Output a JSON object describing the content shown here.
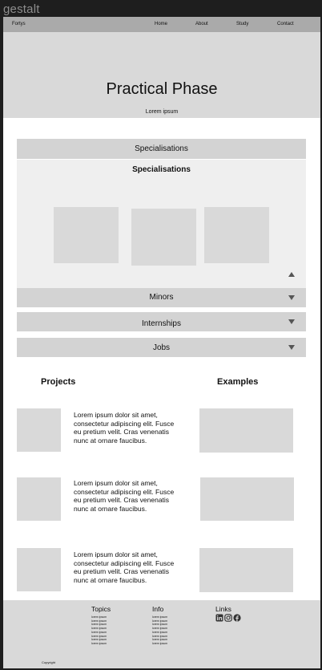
{
  "app": {
    "title": "gestalt"
  },
  "nav": {
    "brand": "Fortys",
    "links": [
      "Home",
      "About",
      "Study",
      "Contact"
    ]
  },
  "hero": {
    "title": "Practical Phase",
    "subtitle": "Lorem ipsum"
  },
  "accordion": {
    "sections": [
      {
        "label": "Specialisations",
        "expanded": true,
        "body_title": "Specialisations"
      },
      {
        "label": "Minors",
        "expanded": false
      },
      {
        "label": "Internships",
        "expanded": false
      },
      {
        "label": "Jobs",
        "expanded": false
      }
    ]
  },
  "projects": {
    "left_title": "Projects",
    "right_title": "Examples",
    "rows": [
      {
        "text": "Lorem ipsum dolor sit amet, consectetur adipiscing elit. Fusce eu pretium velit. Cras venenatis nunc at ornare faucibus."
      },
      {
        "text": "Lorem ipsum dolor sit amet, consectetur adipiscing elit. Fusce eu pretium velit. Cras venenatis nunc at ornare faucibus."
      },
      {
        "text": "Lorem ipsum dolor sit amet, consectetur adipiscing elit. Fusce eu pretium velit. Cras venenatis nunc at ornare faucibus."
      }
    ]
  },
  "footer": {
    "columns": [
      {
        "title": "Topics",
        "items": [
          "lorem ipsum",
          "lorem ipsum",
          "lorem ipsum",
          "lorem ipsum",
          "lorem ipsum",
          "lorem ipsum",
          "lorem ipsum",
          "lorem ipsum"
        ]
      },
      {
        "title": "Info",
        "items": [
          "lorem ipsum",
          "lorem ipsum",
          "lorem ipsum",
          "lorem ipsum",
          "lorem ipsum",
          "lorem ipsum",
          "lorem ipsum",
          "lorem ipsum"
        ]
      },
      {
        "title": "Links",
        "icons": [
          "linkedin-icon",
          "instagram-icon",
          "facebook-icon"
        ]
      }
    ],
    "copyright": "Copyright"
  },
  "colors": {
    "nav": "#aaaaaa",
    "hero": "#d9d9d9",
    "accordion_header": "#d3d3d3",
    "accordion_body": "#efefef",
    "placeholder": "#d9d9d9"
  }
}
